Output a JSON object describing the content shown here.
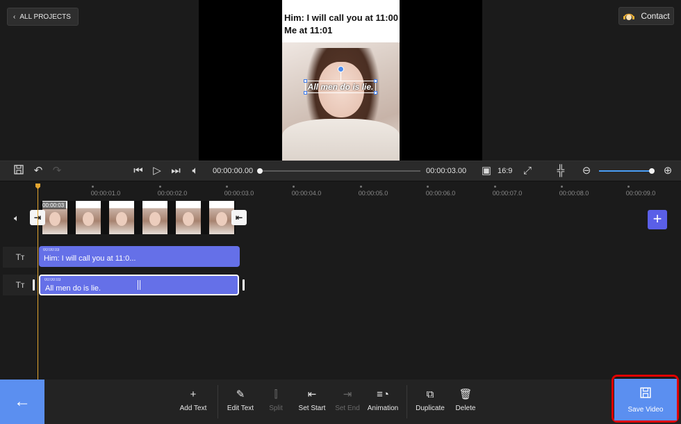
{
  "top": {
    "all_projects_label": "ALL PROJECTS",
    "contact_label": "Contact"
  },
  "preview": {
    "overlay_text_line1": "Him: I will call you at 11:00",
    "overlay_text_line2": "Me at 11:01",
    "caption": "All men do is lie."
  },
  "transport": {
    "current_time": "00:00:00.00",
    "total_time": "00:00:03.00",
    "aspect_ratio": "16:9",
    "zoom_level": 1.0
  },
  "ruler": {
    "labels": [
      "00:00:01.0",
      "00:00:02.0",
      "00:00:03.0",
      "00:00:04.0",
      "00:00:05.0",
      "00:00:06.0",
      "00:00:07.0",
      "00:00:08.0",
      "00:00:09.0"
    ]
  },
  "tracks": {
    "video_clip_time": "00:00:03",
    "text1_time": "00:00:03",
    "text1_label": "Him: I will call you at 11:0...",
    "text2_time": "00:00:03",
    "text2_label": "All men do is lie.",
    "text_track_icon": "Tт"
  },
  "actions": {
    "add_text": "Add Text",
    "edit_text": "Edit Text",
    "split": "Split",
    "set_start": "Set Start",
    "set_end": "Set End",
    "animation": "Animation",
    "duplicate": "Duplicate",
    "delete": "Delete",
    "save_video": "Save Video"
  },
  "colors": {
    "accent": "#5b8ff0",
    "clip": "#6570e8",
    "playhead": "#e3a530",
    "highlight": "#e00000"
  }
}
